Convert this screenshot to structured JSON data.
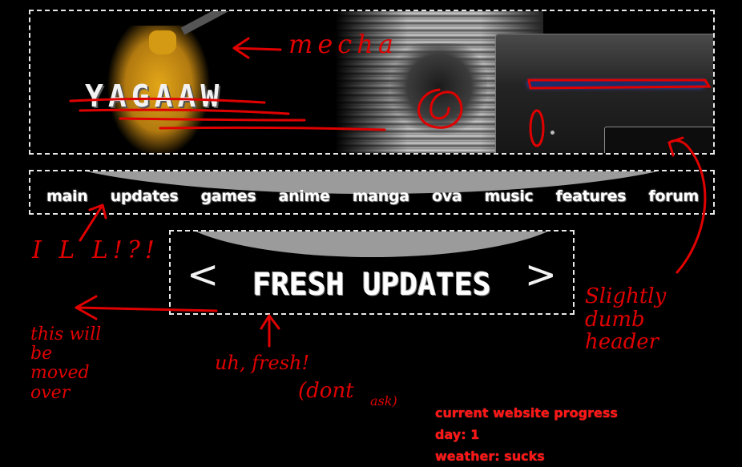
{
  "header": {
    "logo_text": "YAGAAW"
  },
  "nav": {
    "items": [
      "main",
      "updates",
      "games",
      "anime",
      "manga",
      "ova",
      "music",
      "features",
      "forum"
    ]
  },
  "updates_box": {
    "prev_arrow": "<",
    "title": "FRESH UPDATES",
    "next_arrow": ">"
  },
  "annotations": {
    "mecha": "mecha",
    "ill": "I L L!?!",
    "moved": "this will\nbe\nmoved\nover",
    "fresh": "uh, fresh!",
    "dont": "(dont",
    "ask": "ask)",
    "dumb_header": "Slightly\ndumb\nheader"
  },
  "progress": {
    "line1": "current website progress",
    "line2": "day: 1",
    "line3": "weather: sucks"
  },
  "colors": {
    "background": "#000000",
    "annotation_red": "#e00000",
    "nav_arc": "#9b9b9b",
    "text": "#ffffff"
  }
}
